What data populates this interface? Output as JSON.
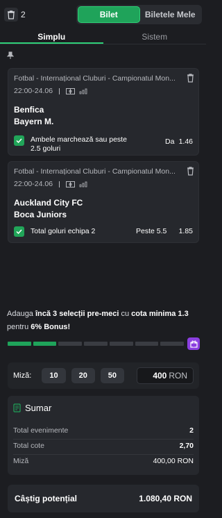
{
  "header": {
    "count": "2",
    "tabs": [
      {
        "label": "Bilet",
        "active": true
      },
      {
        "label": "Biletele Mele",
        "active": false
      }
    ]
  },
  "subtabs": [
    {
      "label": "Simplu",
      "active": true
    },
    {
      "label": "Sistem",
      "active": false
    }
  ],
  "bets": [
    {
      "league": "Fotbal - Internațional Cluburi - Campionatul Mon...",
      "time": "22:00-24.06",
      "home": "Benfica",
      "away": "Bayern M.",
      "market": "Ambele marchează sau peste 2.5 goluri",
      "selection": "Da",
      "odd": "1.46"
    },
    {
      "league": "Fotbal - Internațional Cluburi - Campionatul Mon...",
      "time": "22:00-24.06",
      "home": "Auckland City FC",
      "away": "Boca Juniors",
      "market": "Total goluri echipa 2",
      "selection": "Peste 5.5",
      "odd": "1.85"
    }
  ],
  "bonus": {
    "p1": "Adauga ",
    "b1": "încă 3 selecții pre-meci",
    "p2": " cu ",
    "b2": "cota minima 1.3",
    "p3": " pentru ",
    "b3": "6% Bonus",
    "p4": "!",
    "progress_filled_segments": 2,
    "progress_total_segments": 7
  },
  "stake": {
    "label": "Miză:",
    "chips": [
      "10",
      "20",
      "50"
    ],
    "amount": "400",
    "currency": "RON"
  },
  "summary": {
    "title": "Sumar",
    "rows": [
      {
        "label": "Total evenimente",
        "value": "2"
      },
      {
        "label": "Total cote",
        "value": "2,70"
      },
      {
        "label": "Miză",
        "value": "400,00 RON"
      }
    ]
  },
  "potential": {
    "label": "Câștig potențial",
    "value": "1.080,40 RON"
  },
  "colors": {
    "accent": "#1fa35a",
    "gift": "#8b3fe0"
  }
}
